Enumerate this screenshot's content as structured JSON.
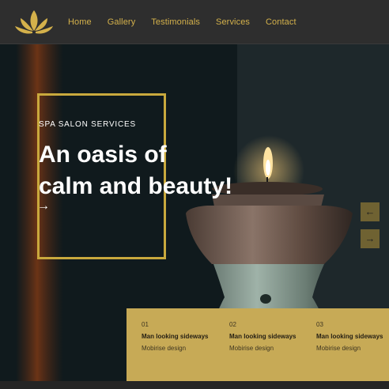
{
  "brand": {
    "logo": "lotus-icon",
    "color": "#d4b14b"
  },
  "nav": {
    "items": [
      {
        "label": "Home"
      },
      {
        "label": "Gallery"
      },
      {
        "label": "Testimonials"
      },
      {
        "label": "Services"
      },
      {
        "label": "Contact"
      }
    ]
  },
  "hero": {
    "subtitle": "SPA SALON SERVICES",
    "title_line1": "An oasis of",
    "title_line2": "calm and beauty!",
    "arrow": "→",
    "prev": "←",
    "next": "→"
  },
  "features": [
    {
      "num": "01",
      "title": "Man looking sideways",
      "subtitle": "Mobirise design"
    },
    {
      "num": "02",
      "title": "Man looking sideways",
      "subtitle": "Mobirise design"
    },
    {
      "num": "03",
      "title": "Man looking sideways",
      "subtitle": "Mobirise design"
    }
  ],
  "colors": {
    "accent": "#c9a93d",
    "panel": "#c7aa56",
    "header": "#2e2e2e"
  }
}
